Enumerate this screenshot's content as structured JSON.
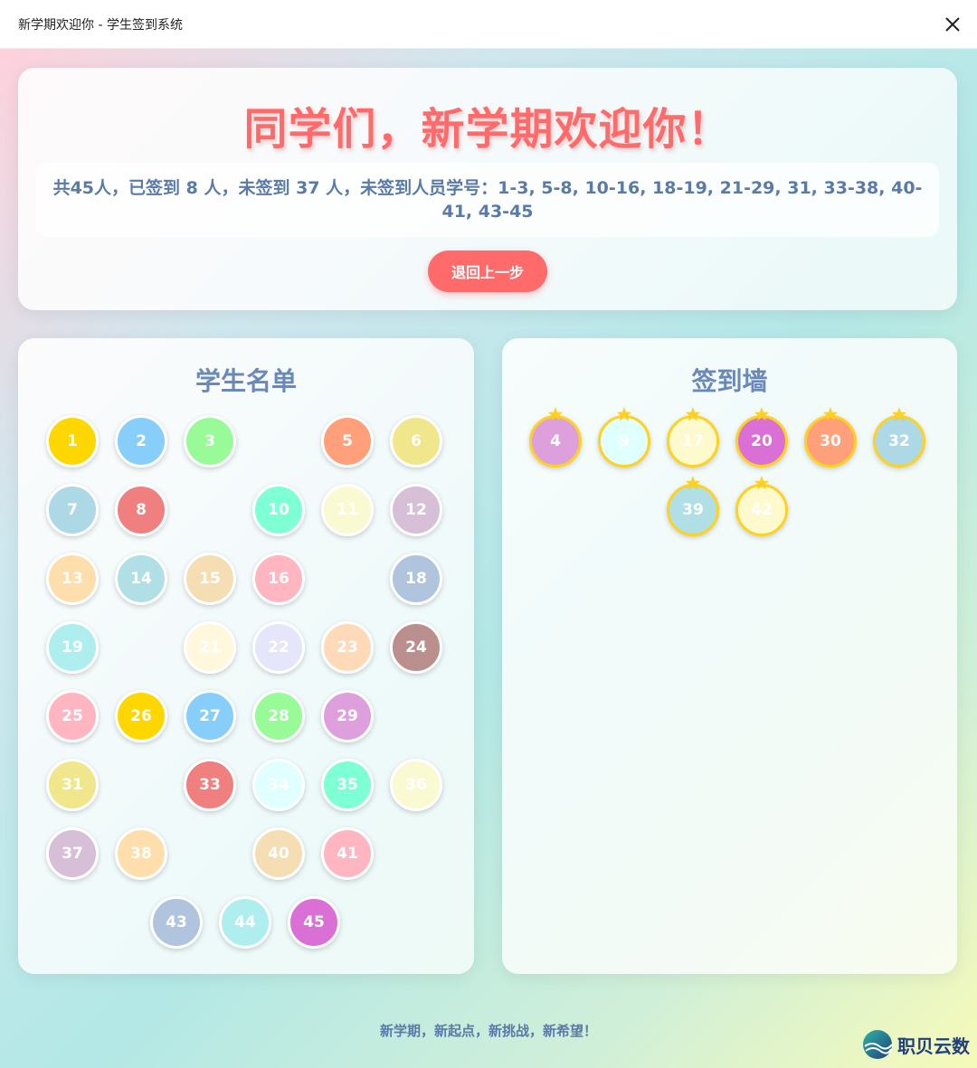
{
  "window": {
    "title": "新学期欢迎你 - 学生签到系统"
  },
  "header": {
    "headline": "同学们，新学期欢迎你！",
    "summary": "共45人，已签到 8 人，未签到 37 人，未签到人员学号：1-3, 5-8, 10-16, 18-19, 21-29, 31, 33-38, 40-41, 43-45",
    "back_label": "退回上一步"
  },
  "roster": {
    "title": "学生名单",
    "students": [
      {
        "n": "1",
        "color": "#ffd700"
      },
      {
        "n": "2",
        "color": "#87cefa"
      },
      {
        "n": "3",
        "color": "#98fb98"
      },
      {
        "n": "5",
        "color": "#ffa07a"
      },
      {
        "n": "6",
        "color": "#f0e68c"
      },
      {
        "n": "7",
        "color": "#add8e6"
      },
      {
        "n": "8",
        "color": "#f08080"
      },
      {
        "n": "10",
        "color": "#7fffd4"
      },
      {
        "n": "11",
        "color": "#fafad2"
      },
      {
        "n": "12",
        "color": "#d8bfd8"
      },
      {
        "n": "13",
        "color": "#ffdead"
      },
      {
        "n": "14",
        "color": "#b0e0e6"
      },
      {
        "n": "15",
        "color": "#f5deb3"
      },
      {
        "n": "16",
        "color": "#ffb6c1"
      },
      {
        "n": "18",
        "color": "#b0c4de"
      },
      {
        "n": "19",
        "color": "#afeeee"
      },
      {
        "n": "21",
        "color": "#fff8dc"
      },
      {
        "n": "22",
        "color": "#e6e6fa"
      },
      {
        "n": "23",
        "color": "#ffdab9"
      },
      {
        "n": "24",
        "color": "#bc8f8f"
      },
      {
        "n": "25",
        "color": "#ffb6c1"
      },
      {
        "n": "26",
        "color": "#ffd700"
      },
      {
        "n": "27",
        "color": "#87cefa"
      },
      {
        "n": "28",
        "color": "#98fb98"
      },
      {
        "n": "29",
        "color": "#dda0dd"
      },
      {
        "n": "31",
        "color": "#f0e68c"
      },
      {
        "n": "33",
        "color": "#f08080"
      },
      {
        "n": "34",
        "color": "#e0ffff"
      },
      {
        "n": "35",
        "color": "#7fffd4"
      },
      {
        "n": "36",
        "color": "#fafad2"
      },
      {
        "n": "37",
        "color": "#d8bfd8"
      },
      {
        "n": "38",
        "color": "#ffdead"
      },
      {
        "n": "40",
        "color": "#f5deb3"
      },
      {
        "n": "41",
        "color": "#ffb6c1"
      },
      {
        "n": "43",
        "color": "#b0c4de"
      },
      {
        "n": "44",
        "color": "#afeeee"
      },
      {
        "n": "45",
        "color": "#da70d6"
      }
    ]
  },
  "wall": {
    "title": "签到墙",
    "signed": [
      {
        "n": "4",
        "color": "#dda0dd"
      },
      {
        "n": "9",
        "color": "#e0ffff"
      },
      {
        "n": "17",
        "color": "#fffacd"
      },
      {
        "n": "20",
        "color": "#da70d6"
      },
      {
        "n": "30",
        "color": "#ffa07a"
      },
      {
        "n": "32",
        "color": "#add8e6"
      },
      {
        "n": "39",
        "color": "#b0e0e6"
      },
      {
        "n": "42",
        "color": "#fffacd"
      }
    ]
  },
  "footer": {
    "slogan": "新学期，新起点，新挑战，新希望！"
  },
  "brand": {
    "name": "职贝云数"
  }
}
